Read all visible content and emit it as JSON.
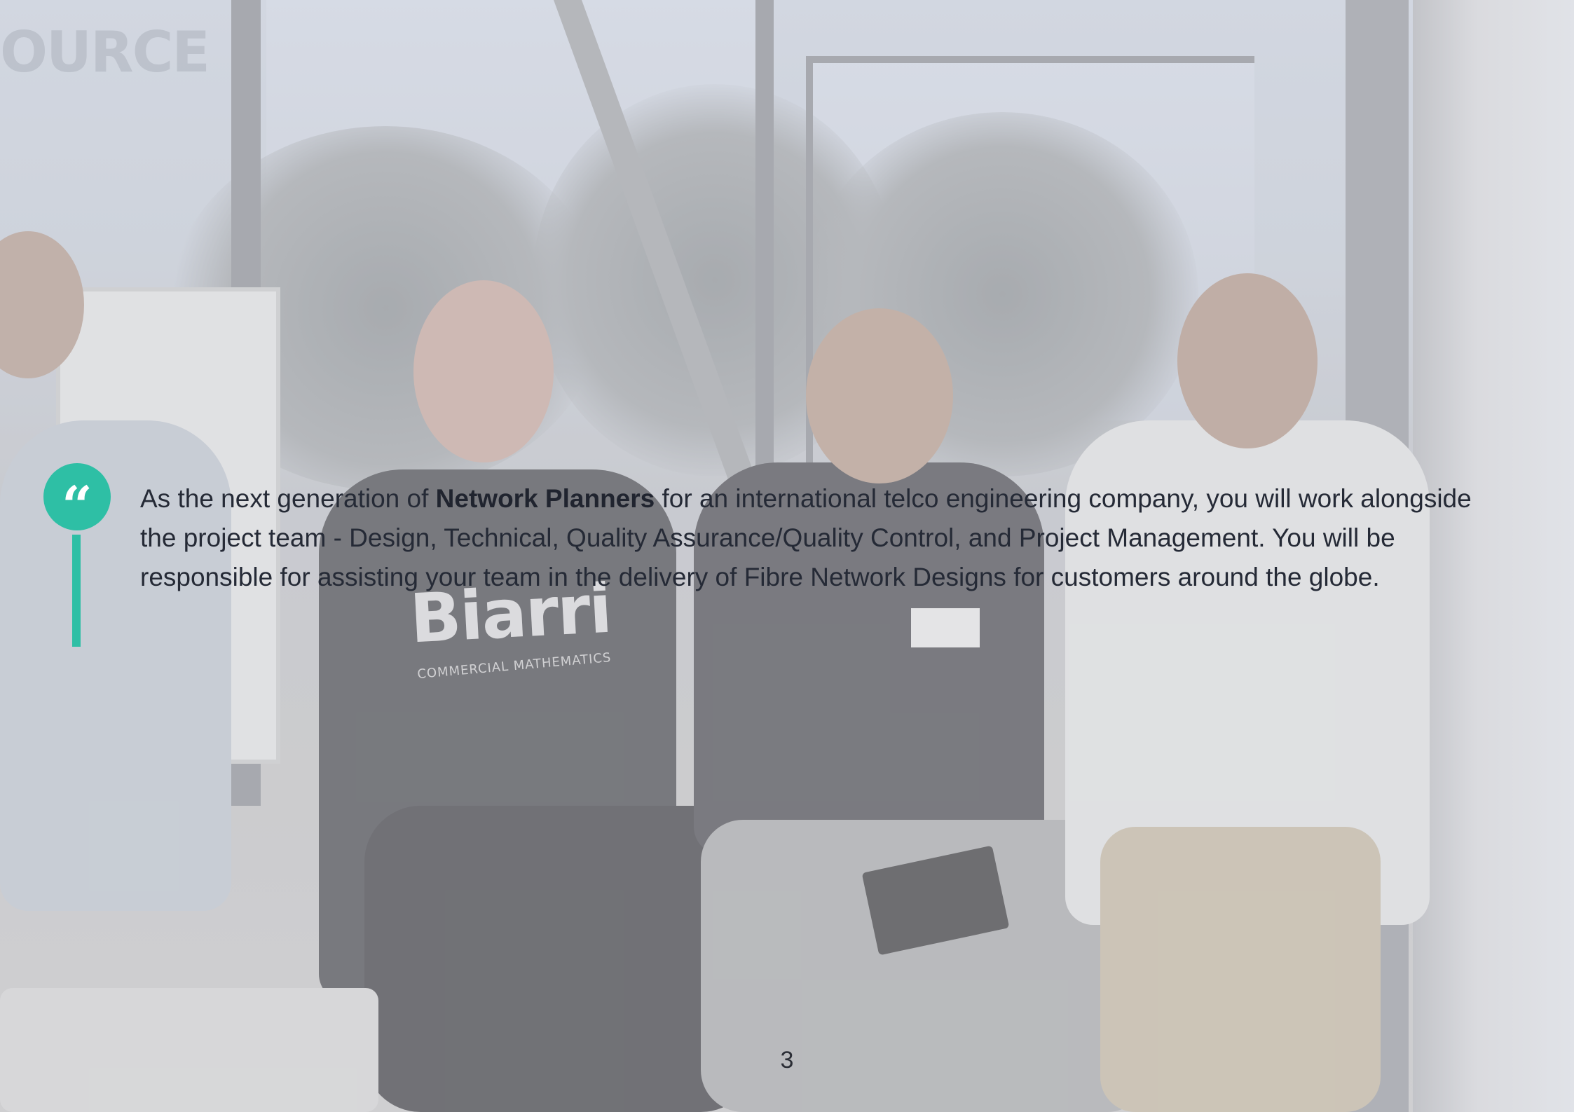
{
  "quote": {
    "icon": "quote-icon",
    "glyph": "“",
    "text_before": "As the next generation of ",
    "text_bold": "Network Planners",
    "text_after": " for an international telco engineering company, you will work alongside the project team - Design, Technical, Quality Assurance/Quality Control, and Project Management. You will be responsible for assisting your team in the delivery of Fibre Network Designs for customers around the globe."
  },
  "background_photo": {
    "sign_text": "OURCE",
    "shirt_logo": "Biarri",
    "shirt_tagline": "COMMERCIAL MATHEMATICS"
  },
  "page_number": "3",
  "colors": {
    "accent": "#2ebfa5",
    "text": "#252a36"
  }
}
